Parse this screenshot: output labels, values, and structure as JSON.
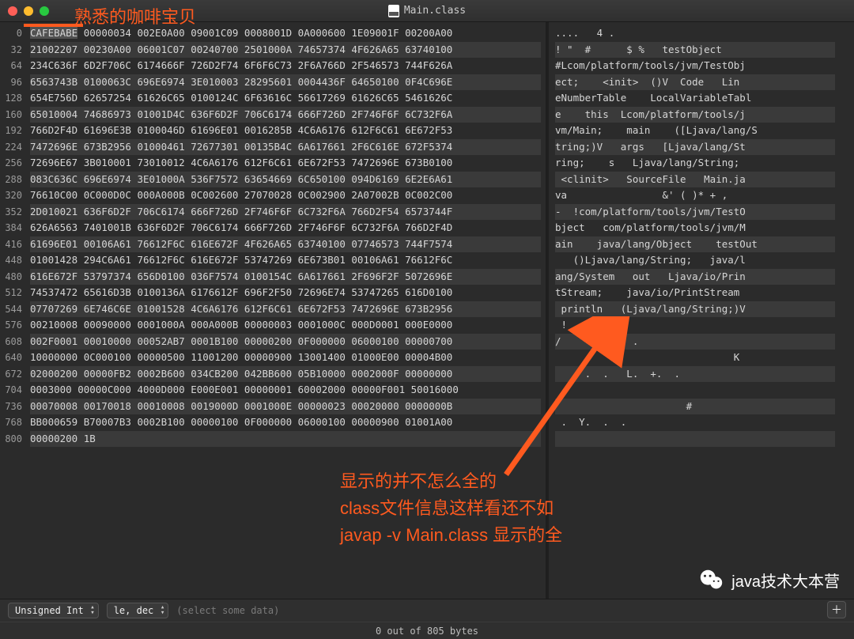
{
  "window": {
    "title": "Main.class"
  },
  "annotations": {
    "top": "熟悉的咖啡宝贝",
    "body_line1": "显示的并不怎么全的",
    "body_line2": "class文件信息这样看还不如",
    "body_line3": " javap  -v  Main.class 显示的全"
  },
  "gutter": [
    "0",
    "32",
    "64",
    "96",
    "128",
    "160",
    "192",
    "224",
    "256",
    "288",
    "320",
    "352",
    "384",
    "416",
    "448",
    "480",
    "512",
    "544",
    "576",
    "608",
    "640",
    "672",
    "704",
    "736",
    "768",
    "800"
  ],
  "hex": [
    "CAFEBABE 00000034 002E0A00 09001C09 0008001D 0A000600 1E09001F 00200A00",
    "21002207 00230A00 06001C07 00240700 2501000A 74657374 4F626A65 63740100",
    "234C636F 6D2F706C 6174666F 726D2F74 6F6F6C73 2F6A766D 2F546573 744F626A",
    "6563743B 0100063C 696E6974 3E010003 28295601 0004436F 64650100 0F4C696E",
    "654E756D 62657254 61626C65 0100124C 6F63616C 56617269 61626C65 5461626C",
    "65010004 74686973 01001D4C 636F6D2F 706C6174 666F726D 2F746F6F 6C732F6A",
    "766D2F4D 61696E3B 0100046D 61696E01 0016285B 4C6A6176 612F6C61 6E672F53",
    "7472696E 673B2956 01000461 72677301 00135B4C 6A617661 2F6C616E 672F5374",
    "72696E67 3B010001 73010012 4C6A6176 612F6C61 6E672F53 7472696E 673B0100",
    "083C636C 696E6974 3E01000A 536F7572 63654669 6C650100 094D6169 6E2E6A61",
    "76610C00 0C000D0C 000A000B 0C002600 27070028 0C002900 2A07002B 0C002C00",
    "2D010021 636F6D2F 706C6174 666F726D 2F746F6F 6C732F6A 766D2F54 6573744F",
    "626A6563 7401001B 636F6D2F 706C6174 666F726D 2F746F6F 6C732F6A 766D2F4D",
    "61696E01 00106A61 76612F6C 616E672F 4F626A65 63740100 07746573 744F7574",
    "01001428 294C6A61 76612F6C 616E672F 53747269 6E673B01 00106A61 76612F6C",
    "616E672F 53797374 656D0100 036F7574 0100154C 6A617661 2F696F2F 5072696E",
    "74537472 65616D3B 0100136A 6176612F 696F2F50 72696E74 53747265 616D0100",
    "07707269 6E746C6E 01001528 4C6A6176 612F6C61 6E672F53 7472696E 673B2956",
    "00210008 00090000 0001000A 000A000B 00000003 0001000C 000D0001 000E0000",
    "002F0001 00010000 00052AB7 0001B100 00000200 0F000000 06000100 00000700",
    "10000000 0C000100 00000500 11001200 00000900 13001400 01000E00 00004B00",
    "02000200 00000FB2 0002B600 034CB200 042BB600 05B10000 0002000F 00000000",
    "0003000 00000C000 4000D000 E000E001 00000001 60002000 00000F001 50016000",
    "00070008 00170018 00010008 0019000D 0001000E 00000023 00020000 0000000B",
    "BB000659 B70007B3 0002B100 00000100 0F000000 06000100 00000900 01001A00",
    "00000200 1B"
  ],
  "ascii": [
    "....   4 .",
    "! \"  #      $ %   testObject",
    "#Lcom/platform/tools/jvm/TestObj",
    "ect;    <init>  ()V  Code   Lin",
    "eNumberTable    LocalVariableTabl",
    "e    this  Lcom/platform/tools/j",
    "vm/Main;    main    ([Ljava/lang/S",
    "tring;)V   args   [Ljava/lang/St",
    "ring;    s   Ljava/lang/String;",
    " <clinit>   SourceFile   Main.ja",
    "va                &' ( )* + ,",
    "-  !com/platform/tools/jvm/TestO",
    "bject   com/platform/tools/jvm/M",
    "ain    java/lang/Object    testOut",
    "   ()Ljava/lang/String;   java/l",
    "ang/System   out   Ljava/io/Prin",
    "tStream;    java/io/PrintStream",
    " println   (Ljava/lang/String;)V",
    " !",
    "/        *.  .",
    "                              K",
    "     .  .   L.  +.  .",
    "",
    "                      #",
    " .  Y.  .  .",
    ""
  ],
  "bottom": {
    "format": "Unsigned Int",
    "endianness": "le, dec",
    "hint": "(select some data)",
    "status": "0 out of 805 bytes"
  },
  "watermark": "java技术大本营"
}
